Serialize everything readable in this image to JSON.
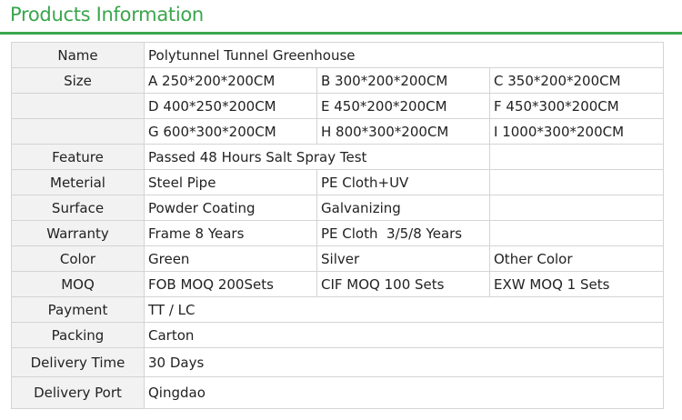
{
  "header": {
    "title": "Products Information"
  },
  "table": {
    "rows": [
      {
        "label": "Name",
        "cells": [
          "Polytunnel Tunnel Greenhouse"
        ]
      },
      {
        "label": "Size",
        "cells": [
          "A 250*200*200CM",
          "B 300*200*200CM",
          "C 350*200*200CM"
        ]
      },
      {
        "label": "",
        "cells": [
          "D 400*250*200CM",
          "E 450*200*200CM",
          "F 450*300*200CM"
        ]
      },
      {
        "label": "",
        "cells": [
          "G 600*300*200CM",
          "H 800*300*200CM",
          "I 1000*300*200CM"
        ]
      },
      {
        "label": "Feature",
        "cells": [
          "Passed 48 Hours Salt Spray Test",
          ""
        ]
      },
      {
        "label": "Meterial",
        "cells": [
          "Steel Pipe",
          "PE Cloth+UV",
          ""
        ]
      },
      {
        "label": "Surface",
        "cells": [
          "Powder Coating",
          "Galvanizing",
          ""
        ]
      },
      {
        "label": "Warranty",
        "cells": [
          "Frame 8 Years",
          "PE Cloth  3/5/8 Years",
          ""
        ]
      },
      {
        "label": "Color",
        "cells": [
          "Green",
          "Silver",
          "Other Color"
        ]
      },
      {
        "label": "MOQ",
        "cells": [
          "FOB MOQ 200Sets",
          "CIF MOQ 100 Sets",
          "EXW MOQ 1 Sets"
        ]
      },
      {
        "label": "Payment",
        "cells": [
          "TT / LC"
        ]
      },
      {
        "label": "Packing",
        "cells": [
          "Carton"
        ]
      },
      {
        "label": "Delivery Time",
        "cells": [
          "30 Days"
        ]
      },
      {
        "label": "Delivery Port",
        "cells": [
          "Qingdao"
        ]
      }
    ]
  },
  "colors": {
    "accent": "#3aa64d",
    "label_bg": "#f2f2f2",
    "border": "#d4d4d4"
  }
}
